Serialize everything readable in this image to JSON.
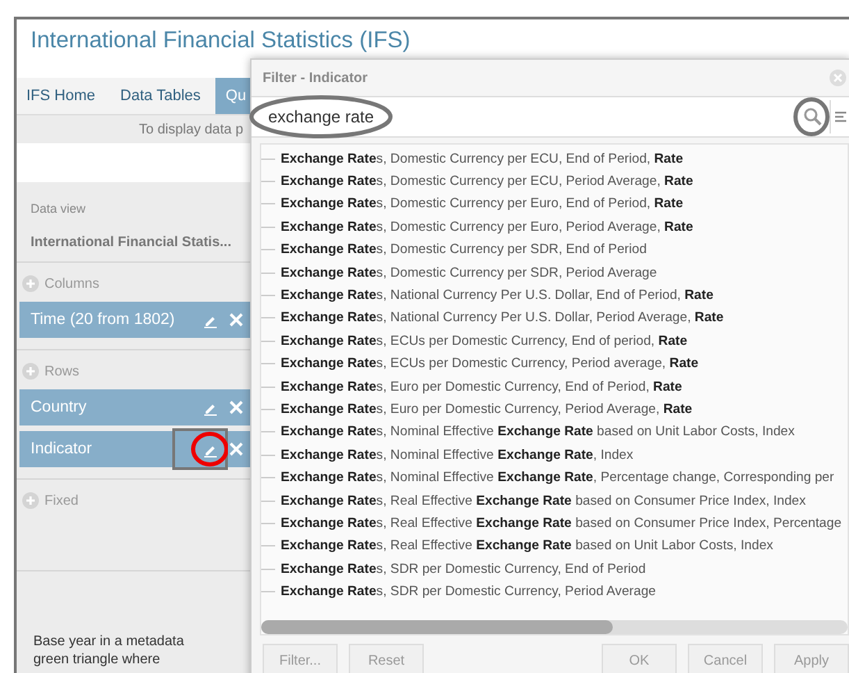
{
  "page": {
    "title": "International Financial Statistics (IFS)"
  },
  "nav": {
    "tabs": [
      {
        "label": "IFS Home",
        "selected": false
      },
      {
        "label": "Data Tables",
        "selected": false
      },
      {
        "label": "Qu",
        "selected": true
      }
    ]
  },
  "notice": "To display data p",
  "sidebar": {
    "data_view_label": "Data view",
    "data_view": "International Financial Statis...",
    "sections": [
      {
        "label": "Columns",
        "items": [
          {
            "label": "Time (20 from 1802)",
            "circled": false
          }
        ]
      },
      {
        "label": "Rows",
        "items": [
          {
            "label": "Country",
            "circled": false
          },
          {
            "label": "Indicator",
            "circled": true
          }
        ]
      },
      {
        "label": "Fixed"
      }
    ],
    "note": "Base year in a metadata green triangle where"
  },
  "dialog": {
    "title": "Filter - Indicator",
    "search": {
      "value": "exchange rate",
      "value_circled": true,
      "button_circled": true
    },
    "results": [
      "**Exchange Rate**s, Domestic Currency per ECU, End of Period, **Rate**",
      "**Exchange Rate**s, Domestic Currency per ECU, Period Average, **Rate**",
      "**Exchange Rate**s, Domestic Currency per Euro, End of Period, **Rate**",
      "**Exchange Rate**s, Domestic Currency per Euro, Period Average, **Rate**",
      "**Exchange Rate**s, Domestic Currency per SDR, End of Period",
      "**Exchange Rate**s, Domestic Currency per SDR, Period Average",
      "**Exchange Rate**s, National Currency Per U.S. Dollar, End of Period, **Rate**",
      "**Exchange Rate**s, National Currency Per U.S. Dollar, Period Average, **Rate**",
      "**Exchange Rate**s, ECUs per Domestic Currency, End of period, **Rate**",
      "**Exchange Rate**s, ECUs per Domestic Currency, Period average, **Rate**",
      "**Exchange Rate**s, Euro per Domestic Currency, End of Period, **Rate**",
      "**Exchange Rate**s, Euro per Domestic Currency, Period Average, **Rate**",
      "**Exchange Rate**s, Nominal Effective **Exchange Rate** based on Unit Labor Costs, Index",
      "**Exchange Rate**s, Nominal Effective **Exchange Rate**, Index",
      "**Exchange Rate**s, Nominal Effective **Exchange Rate**, Percentage change, Corresponding per",
      "**Exchange Rate**s, Real Effective **Exchange Rate** based on Consumer Price Index, Index",
      "**Exchange Rate**s, Real Effective **Exchange Rate** based on Consumer Price Index, Percentage",
      "**Exchange Rate**s, Real Effective **Exchange Rate** based on Unit Labor Costs, Index",
      "**Exchange Rate**s, SDR per Domestic Currency, End of Period",
      "**Exchange Rate**s, SDR per Domestic Currency, Period Average"
    ],
    "left_buttons": [
      "Filter...",
      "Reset"
    ],
    "right_buttons": [
      "OK",
      "Cancel",
      "Apply"
    ]
  }
}
